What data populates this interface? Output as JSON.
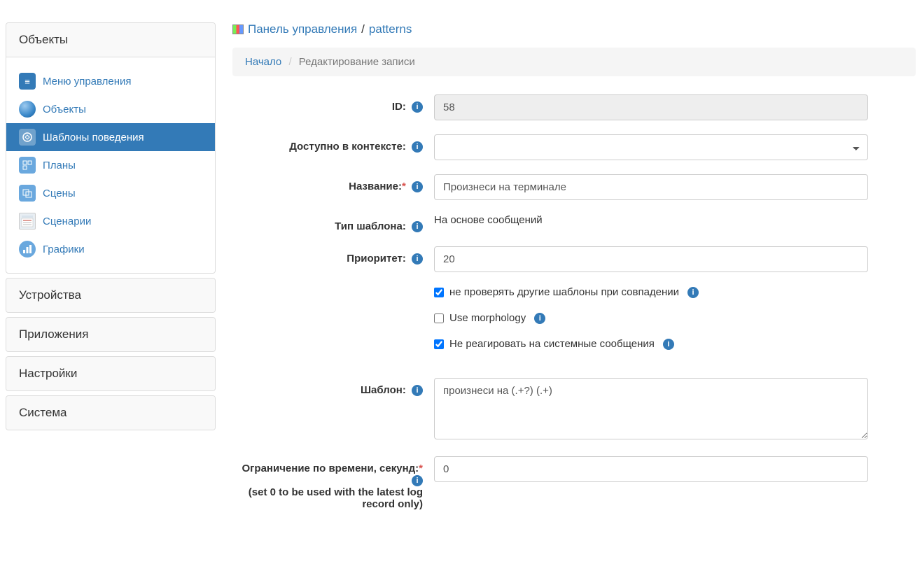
{
  "sidebar": {
    "panels": [
      {
        "title": "Объекты"
      },
      {
        "title": "Устройства"
      },
      {
        "title": "Приложения"
      },
      {
        "title": "Настройки"
      },
      {
        "title": "Система"
      }
    ],
    "nav": [
      {
        "label": "Меню управления",
        "icon": "menu"
      },
      {
        "label": "Объекты",
        "icon": "globe"
      },
      {
        "label": "Шаблоны поведения",
        "icon": "patterns",
        "active": true
      },
      {
        "label": "Планы",
        "icon": "plans"
      },
      {
        "label": "Сцены",
        "icon": "scenes"
      },
      {
        "label": "Сценарии",
        "icon": "scripts"
      },
      {
        "label": "Графики",
        "icon": "charts"
      }
    ]
  },
  "header": {
    "root_label": "Панель управления",
    "section": "patterns",
    "sep": "/"
  },
  "breadcrumb": {
    "home": "Начало",
    "current": "Редактирование записи"
  },
  "form": {
    "id_label": "ID:",
    "id_value": "58",
    "context_label": "Доступно в контексте:",
    "context_value": "",
    "name_label": "Название:",
    "name_value": "Произнеси на терминале",
    "type_label": "Тип шаблона:",
    "type_value": "На основе сообщений",
    "priority_label": "Приоритет:",
    "priority_value": "20",
    "chk_skip_label": "не проверять другие шаблоны при совпадении",
    "chk_skip_checked": true,
    "chk_morph_label": "Use morphology",
    "chk_morph_checked": false,
    "chk_nosys_label": "Не реагировать на системные сообщения",
    "chk_nosys_checked": true,
    "pattern_label": "Шаблон:",
    "pattern_value": "произнеси на (.+?) (.+)",
    "timelimit_label": "Ограничение по времени, секунд:",
    "timelimit_hint": "(set 0 to be used with the latest log record only)",
    "timelimit_value": "0"
  }
}
